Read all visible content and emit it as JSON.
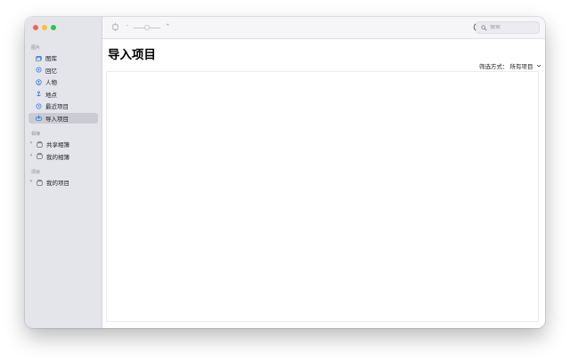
{
  "window": {
    "traffic_lights": {
      "close": "#fe5f57",
      "minimize": "#febc2e",
      "zoom": "#28c840"
    }
  },
  "sidebar": {
    "sections": [
      {
        "header": "图片",
        "items": [
          {
            "label": "图库",
            "icon": "photo-library-icon",
            "selected": false
          },
          {
            "label": "回忆",
            "icon": "memories-icon",
            "selected": false
          },
          {
            "label": "人物",
            "icon": "people-icon",
            "selected": false
          },
          {
            "label": "地点",
            "icon": "places-icon",
            "selected": false
          },
          {
            "label": "最近项目",
            "icon": "recents-icon",
            "selected": false
          },
          {
            "label": "导入项目",
            "icon": "imports-icon",
            "selected": true
          }
        ]
      },
      {
        "header": "相簿",
        "items": [
          {
            "label": "共享相簿",
            "icon": "shared-albums-icon",
            "expandable": true
          },
          {
            "label": "我的相簿",
            "icon": "my-albums-icon",
            "expandable": true
          }
        ]
      },
      {
        "header": "项目",
        "items": [
          {
            "label": "我的项目",
            "icon": "my-projects-icon",
            "expandable": true
          }
        ]
      }
    ]
  },
  "toolbar": {
    "icons": [
      "rotate-icon",
      "info-icon",
      "share-icon",
      "heart-icon",
      "rotate-photo-icon"
    ],
    "zoom": {
      "minus": "-",
      "plus": "+",
      "level": 0.5
    },
    "search": {
      "placeholder": "搜索",
      "value": ""
    }
  },
  "main": {
    "title": "导入项目",
    "filter": {
      "label": "筛选方式：",
      "value": "所有项目"
    }
  },
  "colors": {
    "sidebar_bg": "#e4e5ea",
    "selection": "#cbccd3",
    "accent": "#1f6fe5"
  }
}
